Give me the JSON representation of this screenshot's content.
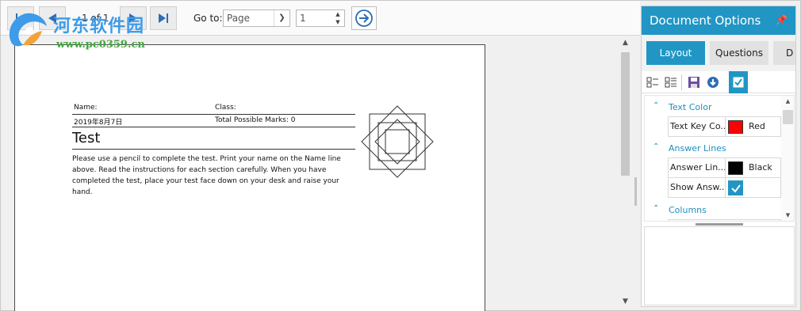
{
  "toolbar": {
    "page_count": "1 of 1",
    "goto_label": "Go to:",
    "goto_type": "Page",
    "page_number": "1"
  },
  "watermark": {
    "title": "河东软件园",
    "url": "www.pc0359.cn"
  },
  "document": {
    "name_label": "Name:",
    "class_label": "Class:",
    "date": "2019年8月7日",
    "total_marks": "Total Possible Marks: 0",
    "title": "Test",
    "instructions": "Please use a pencil to complete the test. Print your name on the Name line above. Read the instructions for each section carefully. When you have completed the test, place your test face down on your desk and raise your hand."
  },
  "options": {
    "title": "Document Options",
    "tabs": [
      "Layout",
      "Questions",
      "D"
    ],
    "sections": {
      "text_color": "Text Color",
      "answer_lines": "Answer Lines",
      "columns": "Columns"
    },
    "props": {
      "text_key_color": {
        "name": "Text Key Co...",
        "value": "Red",
        "color": "#ff0000"
      },
      "answer_line_color": {
        "name": "Answer Lin...",
        "value": "Black",
        "color": "#000000"
      },
      "show_answer": {
        "name": "Show Answ...",
        "checked": true
      }
    }
  },
  "colors": {
    "accent": "#2196c4",
    "nav_icon": "#2d6db5"
  }
}
